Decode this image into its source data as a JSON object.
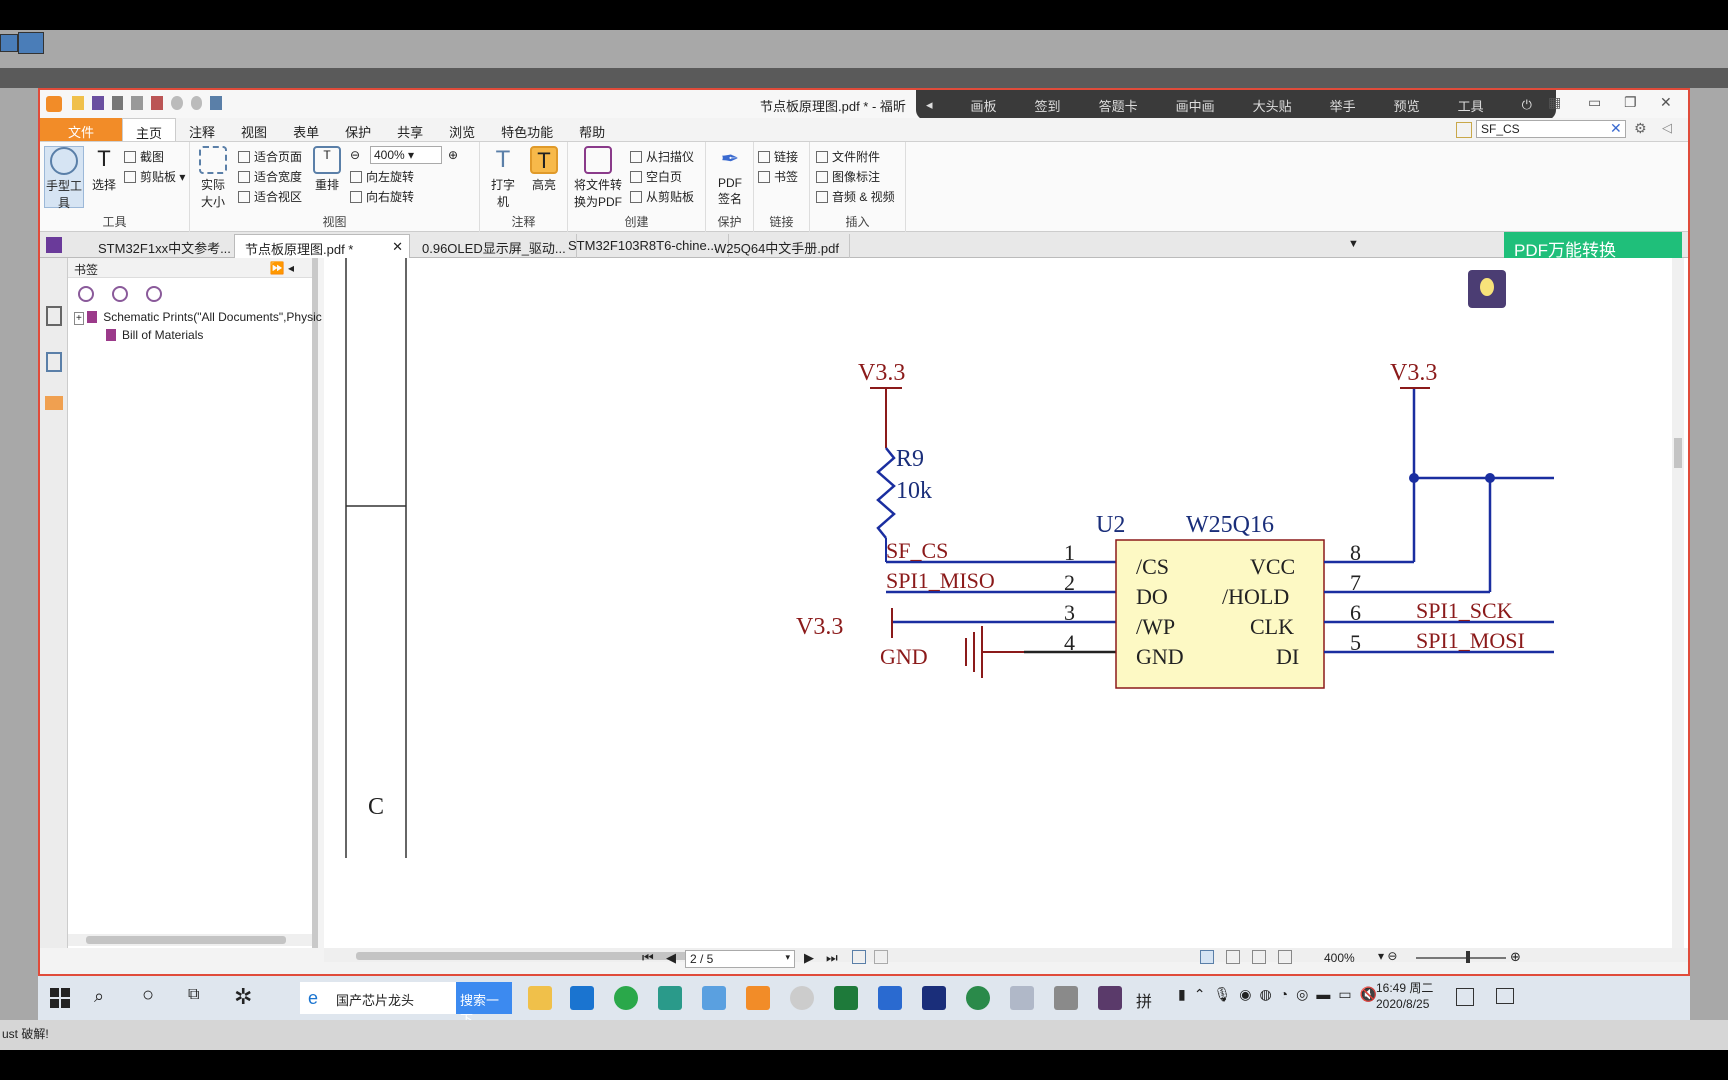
{
  "window": {
    "title": "节点板原理图.pdf * - 福昕"
  },
  "overlay_toolbar": [
    "画板",
    "签到",
    "答题卡",
    "画中画",
    "大头贴",
    "举手",
    "预览",
    "工具"
  ],
  "menu": [
    "文件",
    "主页",
    "注释",
    "视图",
    "表单",
    "保护",
    "共享",
    "浏览",
    "特色功能",
    "帮助"
  ],
  "search": {
    "value": "SF_CS"
  },
  "ribbon": {
    "tools": {
      "hand": "手型工具",
      "select": "选择",
      "screenshot": "截图",
      "clipboard": "剪贴板",
      "label": "工具"
    },
    "view": {
      "actual_size": "实际大小",
      "fit_page": "适合页面",
      "fit_width": "适合宽度",
      "fit_view": "适合视区",
      "reflow": "重排",
      "zoom": "400%",
      "rotate_left": "向左旋转",
      "rotate_right": "向右旋转",
      "label": "视图"
    },
    "annotate": {
      "typewriter": "打字机",
      "highlight": "高亮",
      "label": "注释"
    },
    "create": {
      "convert": "将文件转换为PDF",
      "scanner": "从扫描仪",
      "blank": "空白页",
      "from_clipboard": "从剪贴板",
      "label": "创建"
    },
    "protect": {
      "sign": "PDF签名",
      "label": "保护"
    },
    "links": {
      "link": "链接",
      "bookmark": "书签",
      "label": "链接"
    },
    "insert": {
      "attachment": "文件附件",
      "image": "图像标注",
      "media": "音频 & 视频",
      "label": "插入"
    }
  },
  "tabs": [
    "STM32F1xx中文参考...",
    "节点板原理图.pdf *",
    "0.96OLED显示屏_驱动...",
    "STM32F103R8T6-chine...",
    "W25Q64中文手册.pdf"
  ],
  "pdf_convert": "PDF万能转换",
  "bookmarks": {
    "title": "书签",
    "items": [
      "Schematic Prints(\"All Documents\",Physic",
      "Bill of Materials"
    ]
  },
  "schematic": {
    "v33_left": "V3.3",
    "v33_right": "V3.3",
    "v33_wp": "V3.3",
    "gnd": "GND",
    "resistor": "R9",
    "resistor_value": "10k",
    "ref": "U2",
    "part": "W25Q16",
    "sf_cs": "SF_CS",
    "miso": "SPI1_MISO",
    "sck": "SPI1_SCK",
    "mosi": "SPI1_MOSI",
    "left_pins": [
      {
        "num": "1",
        "name": "/CS"
      },
      {
        "num": "2",
        "name": "DO"
      },
      {
        "num": "3",
        "name": "/WP"
      },
      {
        "num": "4",
        "name": "GND"
      }
    ],
    "right_pins": [
      {
        "num": "8",
        "name": "VCC"
      },
      {
        "num": "7",
        "name": "/HOLD"
      },
      {
        "num": "6",
        "name": "CLK"
      },
      {
        "num": "5",
        "name": "DI"
      }
    ],
    "border_letter": "C"
  },
  "statusbar": {
    "page": "2 / 5",
    "zoom": "400%"
  },
  "taskbar": {
    "search_text": "国产芯片龙头",
    "search_button": "搜索一下",
    "time": "16:49 周二",
    "date": "2020/8/25"
  },
  "bottom_text": "ust 破解!"
}
